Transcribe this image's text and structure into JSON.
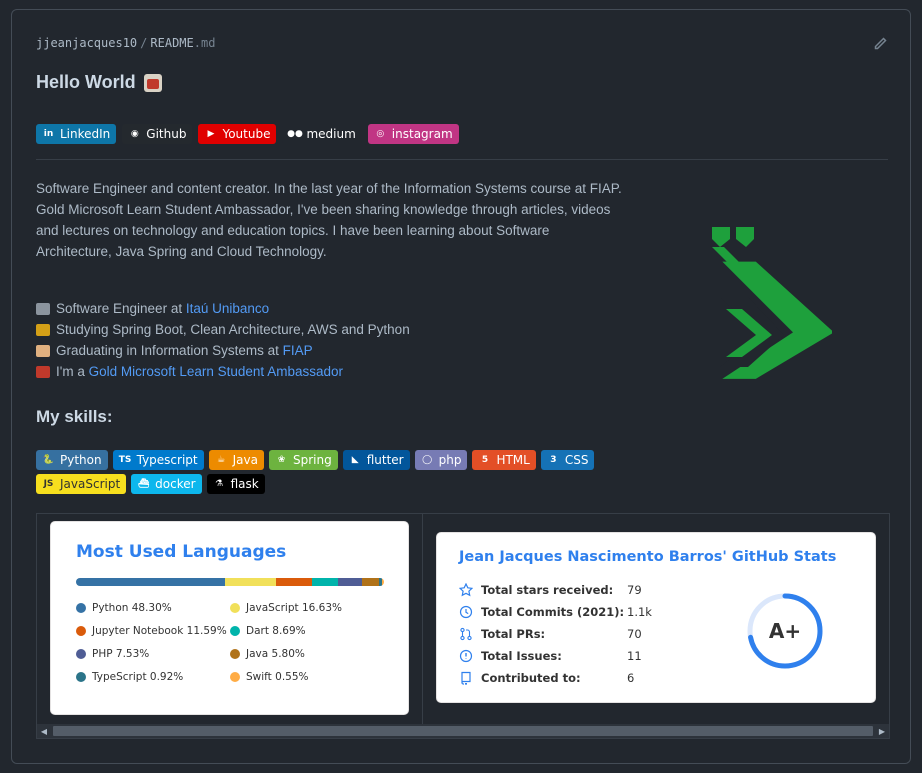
{
  "path": {
    "user": "jjeanjacques10",
    "separator": "/",
    "file": "README",
    "ext": ".md"
  },
  "title": "Hello World",
  "socials": [
    {
      "label": "LinkedIn",
      "color": "#0e76a8",
      "icon": "linkedin-icon",
      "glyph": "in"
    },
    {
      "label": "Github",
      "color": "#24292e",
      "icon": "github-icon",
      "glyph": "◉"
    },
    {
      "label": "Youtube",
      "color": "#e00000",
      "icon": "youtube-icon",
      "glyph": "▶"
    },
    {
      "label": "medium",
      "color": "#22272e",
      "icon": "medium-icon",
      "glyph": "●●"
    },
    {
      "label": "instagram",
      "color": "#c13584",
      "icon": "instagram-icon",
      "glyph": "◎"
    }
  ],
  "about": "Software Engineer and content creator. In the last year of the Information Systems course at FIAP. Gold Microsoft Learn Student Ambassador, I've been sharing knowledge through articles, videos and lectures on technology and education topics. I have been learning about Software Architecture, Java Spring and Cloud Technology.",
  "list": [
    {
      "prefix": "Software Engineer at ",
      "link": "Itaú Unibanco",
      "icon": "laptop-icon",
      "emoji_color": "#8b949e"
    },
    {
      "prefix": "Studying Spring Boot, Clean Architecture, AWS and Python",
      "link": "",
      "icon": "books-icon",
      "emoji_color": "#d4a017"
    },
    {
      "prefix": "Graduating in Information Systems at ",
      "link": "FIAP",
      "icon": "student-icon",
      "emoji_color": "#e0b080"
    },
    {
      "prefix": "I'm a ",
      "link": "Gold Microsoft Learn Student Ambassador",
      "icon": "gift-icon",
      "emoji_color": "#c0392b"
    }
  ],
  "skills_title": "My skills:",
  "skills_row1": [
    {
      "label": "Python",
      "color": "#3670a0",
      "icon": "python-icon",
      "glyph": "🐍"
    },
    {
      "label": "Typescript",
      "color": "#007acc",
      "icon": "typescript-icon",
      "glyph": "TS"
    },
    {
      "label": "Java",
      "color": "#ed8b00",
      "icon": "java-icon",
      "glyph": "☕"
    },
    {
      "label": "Spring",
      "color": "#6db33f",
      "icon": "spring-icon",
      "glyph": "❀"
    },
    {
      "label": "flutter",
      "color": "#02569b",
      "icon": "flutter-icon",
      "glyph": "◣"
    },
    {
      "label": "php",
      "color": "#777bb4",
      "icon": "php-icon",
      "glyph": "◯"
    },
    {
      "label": "HTML",
      "color": "#e34f26",
      "icon": "html5-icon",
      "glyph": "5"
    },
    {
      "label": "CSS",
      "color": "#1572b6",
      "icon": "css3-icon",
      "glyph": "3"
    }
  ],
  "skills_row2": [
    {
      "label": "JavaScript",
      "color": "#f7df1e",
      "icon": "javascript-icon",
      "glyph": "JS",
      "text": "#323330"
    },
    {
      "label": "docker",
      "color": "#0db7ed",
      "icon": "docker-icon",
      "glyph": "⛴"
    },
    {
      "label": "flask",
      "color": "#000000",
      "icon": "flask-icon",
      "glyph": "⚗"
    }
  ],
  "langs": {
    "title": "Most Used Languages",
    "items": [
      {
        "name": "Python",
        "value": 48.3,
        "pct": "48.30%",
        "color": "#3572A5"
      },
      {
        "name": "JavaScript",
        "value": 16.63,
        "pct": "16.63%",
        "color": "#f1e05a"
      },
      {
        "name": "Jupyter Notebook",
        "value": 11.59,
        "pct": "11.59%",
        "color": "#DA5B0B"
      },
      {
        "name": "Dart",
        "value": 8.69,
        "pct": "8.69%",
        "color": "#00B4AB"
      },
      {
        "name": "PHP",
        "value": 7.53,
        "pct": "7.53%",
        "color": "#4F5D95"
      },
      {
        "name": "Java",
        "value": 5.8,
        "pct": "5.80%",
        "color": "#b07219"
      },
      {
        "name": "TypeScript",
        "value": 0.92,
        "pct": "0.92%",
        "color": "#2b7489"
      },
      {
        "name": "Swift",
        "value": 0.55,
        "pct": "0.55%",
        "color": "#ffac45"
      }
    ]
  },
  "gh": {
    "title": "Jean Jacques Nascimento Barros' GitHub Stats",
    "rows": [
      {
        "label": "Total stars received:",
        "value": "79",
        "icon": "star-icon"
      },
      {
        "label": "Total Commits (2021):",
        "value": "1.1k",
        "icon": "clock-icon"
      },
      {
        "label": "Total PRs:",
        "value": "70",
        "icon": "pull-request-icon"
      },
      {
        "label": "Total Issues:",
        "value": "11",
        "icon": "issue-icon"
      },
      {
        "label": "Contributed to:",
        "value": "6",
        "icon": "repo-icon"
      }
    ],
    "grade": "A+",
    "ring_fraction": 0.72,
    "ring_color": "#2f80ed"
  },
  "logo_color": "#1ea03c"
}
